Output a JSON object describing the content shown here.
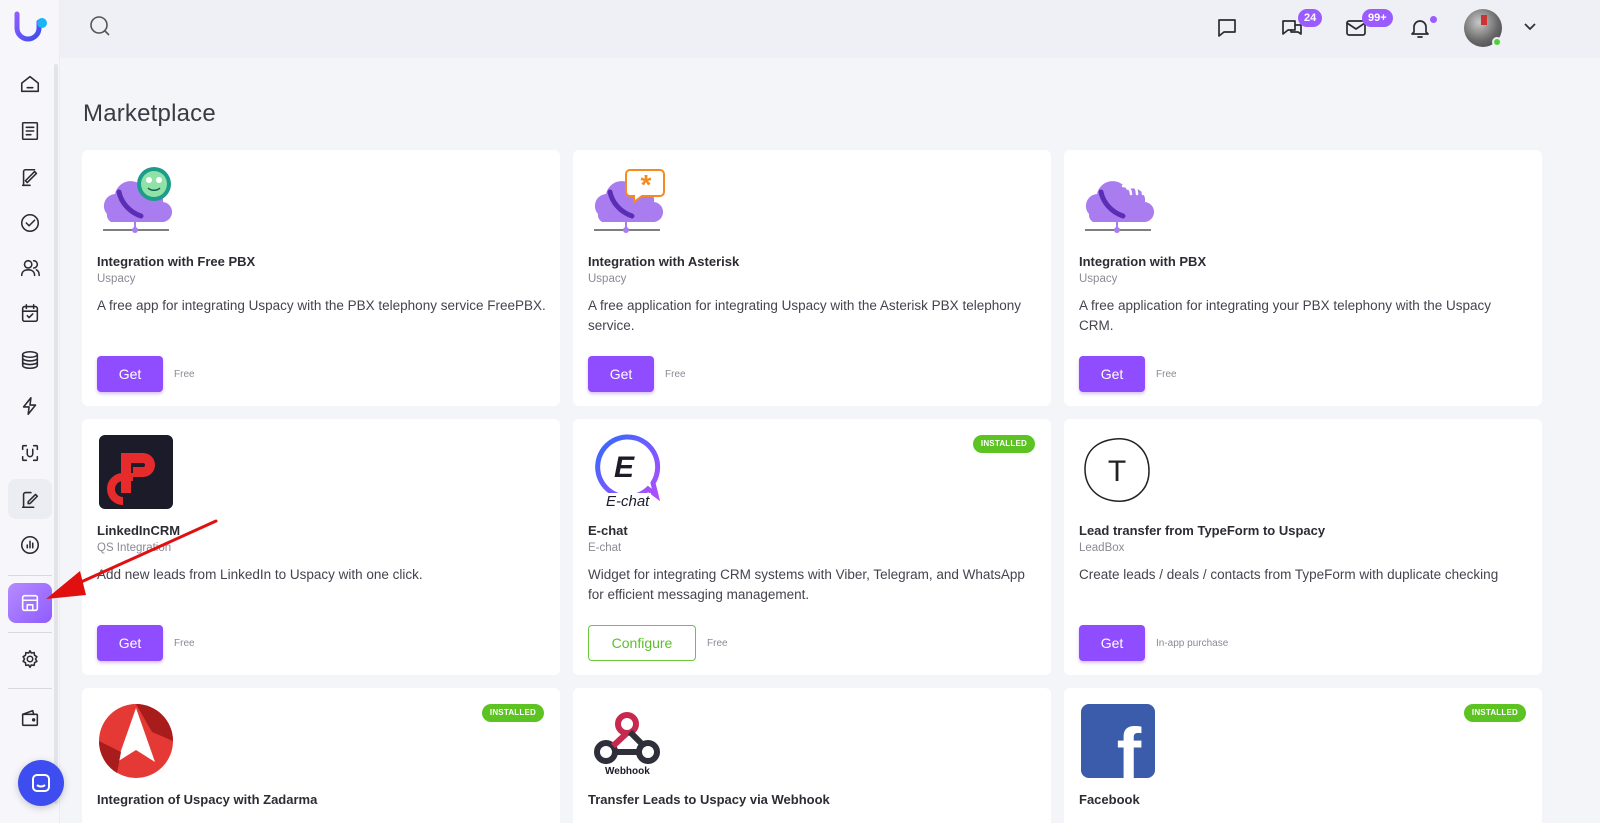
{
  "page": {
    "title": "Marketplace"
  },
  "topbar": {
    "badges": {
      "messages": "24",
      "mail": "99+"
    }
  },
  "icons": {
    "sidebar": [
      "home-icon",
      "list-icon",
      "pen-icon",
      "check-circle-icon",
      "users-icon",
      "calendar-check-icon",
      "database-icon",
      "lightning-icon",
      "scan-u-icon",
      "sign-icon",
      "chart-icon",
      "store-icon",
      "gear-icon",
      "wallet-icon"
    ]
  },
  "colors": {
    "accent": "#8f4dff",
    "installed": "#5cc322",
    "background": "#f4f5f9"
  },
  "cards": [
    {
      "name": "Integration with Free PBX",
      "vendor": "Uspacy",
      "desc": "A free app for integrating Uspacy with the PBX telephony service FreePBX.",
      "action": "Get",
      "price": "Free"
    },
    {
      "name": "Integration with Asterisk",
      "vendor": "Uspacy",
      "desc": "A free application for integrating Uspacy with the Asterisk PBX telephony service.",
      "action": "Get",
      "price": "Free"
    },
    {
      "name": "Integration with PBX",
      "vendor": "Uspacy",
      "desc": "A free application for integrating your PBX telephony with the Uspacy CRM.",
      "action": "Get",
      "price": "Free"
    },
    {
      "name": "LinkedInCRM",
      "vendor": "QS Integration",
      "desc": "Add new leads from LinkedIn to Uspacy with one click.",
      "action": "Get",
      "price": "Free"
    },
    {
      "name": "E-chat",
      "vendor": "E-chat",
      "desc": "Widget for integrating CRM systems with Viber, Telegram, and WhatsApp for efficient messaging management.",
      "action": "Configure",
      "price": "Free",
      "badge": "INSTALLED",
      "logo_text": "E-chat",
      "logo_letter": "E"
    },
    {
      "name": "Lead transfer from TypeForm to Uspacy",
      "vendor": "LeadBox",
      "desc": "Create leads / deals / contacts from TypeForm with duplicate checking",
      "action": "Get",
      "price": "In-app purchase",
      "logo_letter": "T"
    },
    {
      "name": "Integration of Uspacy with Zadarma",
      "badge": "INSTALLED"
    },
    {
      "name": "Transfer Leads to Uspacy via Webhook",
      "logo_text": "Webhook"
    },
    {
      "name": "Facebook",
      "badge": "INSTALLED",
      "logo_letter": "f"
    }
  ]
}
